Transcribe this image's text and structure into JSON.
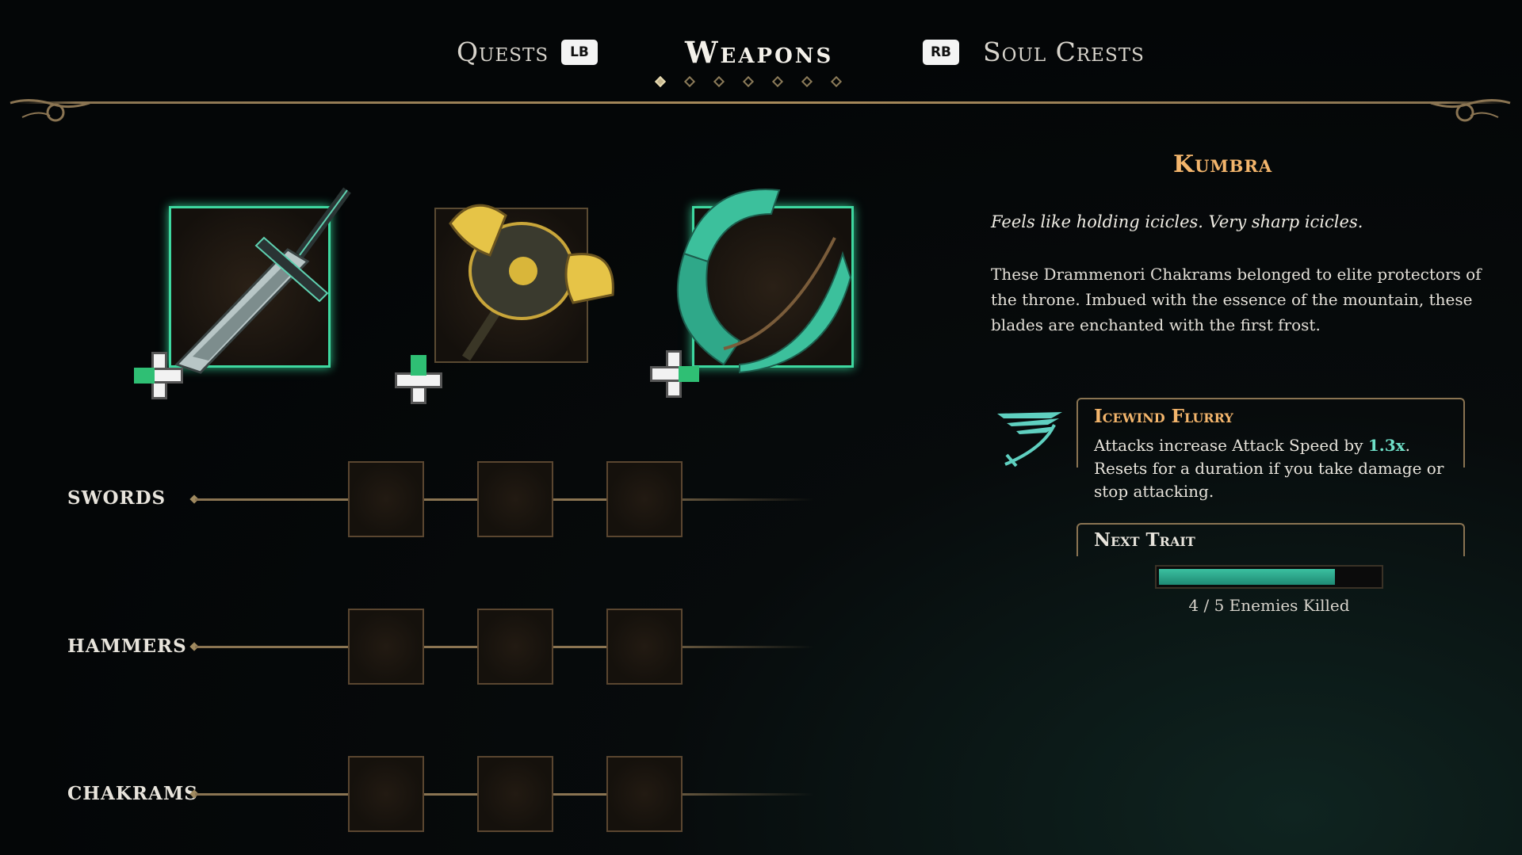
{
  "nav": {
    "left_tab": "Quests",
    "left_key": "LB",
    "active_tab": "Weapons",
    "right_key": "RB",
    "right_tab": "Soul Crests",
    "page_count": 7,
    "active_page": 1
  },
  "equipped": [
    {
      "name": "sword",
      "icon": "sword-icon",
      "selected": true
    },
    {
      "name": "hammer",
      "icon": "hammer-icon",
      "selected": false
    },
    {
      "name": "chakram",
      "icon": "chakram-icon",
      "selected": true
    }
  ],
  "categories": [
    {
      "label": "SWORDS"
    },
    {
      "label": "HAMMERS"
    },
    {
      "label": "CHAKRAMS"
    }
  ],
  "weapon": {
    "name": "Kumbra",
    "flavor": "Feels like holding icicles. Very sharp icicles.",
    "description": "These Drammenori Chakrams belonged to elite protectors of the throne. Imbued with the essence of the mountain, these blades are enchanted with the first frost."
  },
  "trait": {
    "icon": "winged-blade-icon",
    "name": "Icewind Flurry",
    "desc_before": "Attacks increase Attack Speed by ",
    "desc_value": "1.3x",
    "desc_after": ". Resets for a duration if you take damage or stop attacking."
  },
  "next_trait": {
    "title": "Next Trait",
    "progress": 0.8,
    "progress_text": "4 / 5 Enemies Killed"
  },
  "colors": {
    "accent_teal": "#3ed8a0",
    "name_orange": "#f3b56c",
    "frame_gold": "#8a7452"
  }
}
